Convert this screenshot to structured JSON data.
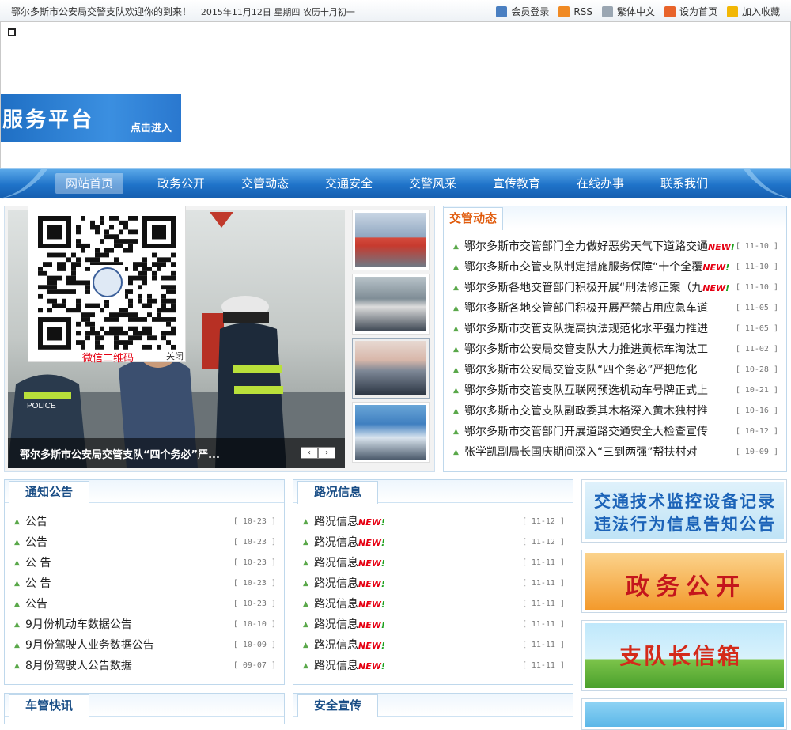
{
  "topbar": {
    "welcome": "鄂尔多斯市公安局交警支队欢迎你的到来！",
    "date": "2015年11月12日  星期四  农历十月初一",
    "links": [
      {
        "label": "会员登录",
        "icon": "member-login-icon",
        "color": "#4a7fc1"
      },
      {
        "label": "RSS",
        "icon": "rss-icon",
        "color": "#f08a24"
      },
      {
        "label": "繁体中文",
        "icon": "document-icon",
        "color": "#9aa6b2"
      },
      {
        "label": "设为首页",
        "icon": "home-icon",
        "color": "#e8632a"
      },
      {
        "label": "加入收藏",
        "icon": "star-icon",
        "color": "#f2b705"
      }
    ]
  },
  "banner": {
    "service_text": "服务平台",
    "enter_text": "点击进入"
  },
  "nav": {
    "items": [
      "网站首页",
      "政务公开",
      "交管动态",
      "交通安全",
      "交警风采",
      "宣传教育",
      "在线办事",
      "联系我们"
    ]
  },
  "slider": {
    "caption": "鄂尔多斯市公安局交管支队“四个务必”严...",
    "prev": "‹",
    "next": "›"
  },
  "qr": {
    "caption": "微信二维码",
    "close": "关闭"
  },
  "news": {
    "title": "交管动态",
    "items": [
      {
        "text": "鄂尔多斯市交管部门全力做好恶劣天气下道路交通",
        "date": "[ 11-10 ]",
        "new": true
      },
      {
        "text": "鄂尔多斯市交管支队制定措施服务保障“十个全覆",
        "date": "[ 11-10 ]",
        "new": true
      },
      {
        "text": "鄂尔多斯各地交管部门积极开展“刑法修正案（九",
        "date": "[ 11-10 ]",
        "new": true
      },
      {
        "text": "鄂尔多斯各地交管部门积极开展严禁占用应急车道",
        "date": "[ 11-05 ]",
        "new": false
      },
      {
        "text": "鄂尔多斯市交管支队提高执法规范化水平强力推进",
        "date": "[ 11-05 ]",
        "new": false
      },
      {
        "text": "鄂尔多斯市公安局交管支队大力推进黄标车淘汰工",
        "date": "[ 11-02 ]",
        "new": false
      },
      {
        "text": "鄂尔多斯市公安局交管支队“四个务必”严把危化",
        "date": "[ 10-28 ]",
        "new": false
      },
      {
        "text": "鄂尔多斯市交管支队互联网预选机动车号牌正式上",
        "date": "[ 10-21 ]",
        "new": false
      },
      {
        "text": "鄂尔多斯市交管支队副政委其木格深入黄木独村推",
        "date": "[ 10-16 ]",
        "new": false
      },
      {
        "text": "鄂尔多斯市交管部门开展道路交通安全大检查宣传",
        "date": "[ 10-12 ]",
        "new": false
      },
      {
        "text": "张学凯副局长国庆期间深入“三到两强”帮扶村对",
        "date": "[ 10-09 ]",
        "new": false
      }
    ],
    "new_label": "NEW!"
  },
  "notice": {
    "title": "通知公告",
    "items": [
      {
        "text": "公告",
        "date": "[ 10-23 ]"
      },
      {
        "text": "公告",
        "date": "[ 10-23 ]"
      },
      {
        "text": "公 告",
        "date": "[ 10-23 ]"
      },
      {
        "text": "公 告",
        "date": "[ 10-23 ]"
      },
      {
        "text": "公告",
        "date": "[ 10-23 ]"
      },
      {
        "text": "9月份机动车数据公告",
        "date": "[ 10-10 ]"
      },
      {
        "text": "9月份驾驶人业务数据公告",
        "date": "[ 10-09 ]"
      },
      {
        "text": "8月份驾驶人公告数据",
        "date": "[ 09-07 ]"
      }
    ]
  },
  "road": {
    "title": "路况信息",
    "items": [
      {
        "text": "路况信息",
        "date": "[ 11-12 ]"
      },
      {
        "text": "路况信息",
        "date": "[ 11-12 ]"
      },
      {
        "text": "路况信息",
        "date": "[ 11-11 ]"
      },
      {
        "text": "路况信息",
        "date": "[ 11-11 ]"
      },
      {
        "text": "路况信息",
        "date": "[ 11-11 ]"
      },
      {
        "text": "路况信息",
        "date": "[ 11-11 ]"
      },
      {
        "text": "路况信息",
        "date": "[ 11-11 ]"
      },
      {
        "text": "路况信息",
        "date": "[ 11-11 ]"
      }
    ]
  },
  "bottom": {
    "left_title": "车管快讯",
    "mid_title": "安全宣传"
  },
  "ads": {
    "monitor_line1": "交通技术监控设备记录",
    "monitor_line2": "违法行为信息告知公告",
    "gov": "政务公开",
    "mailbox": "支队长信箱"
  }
}
